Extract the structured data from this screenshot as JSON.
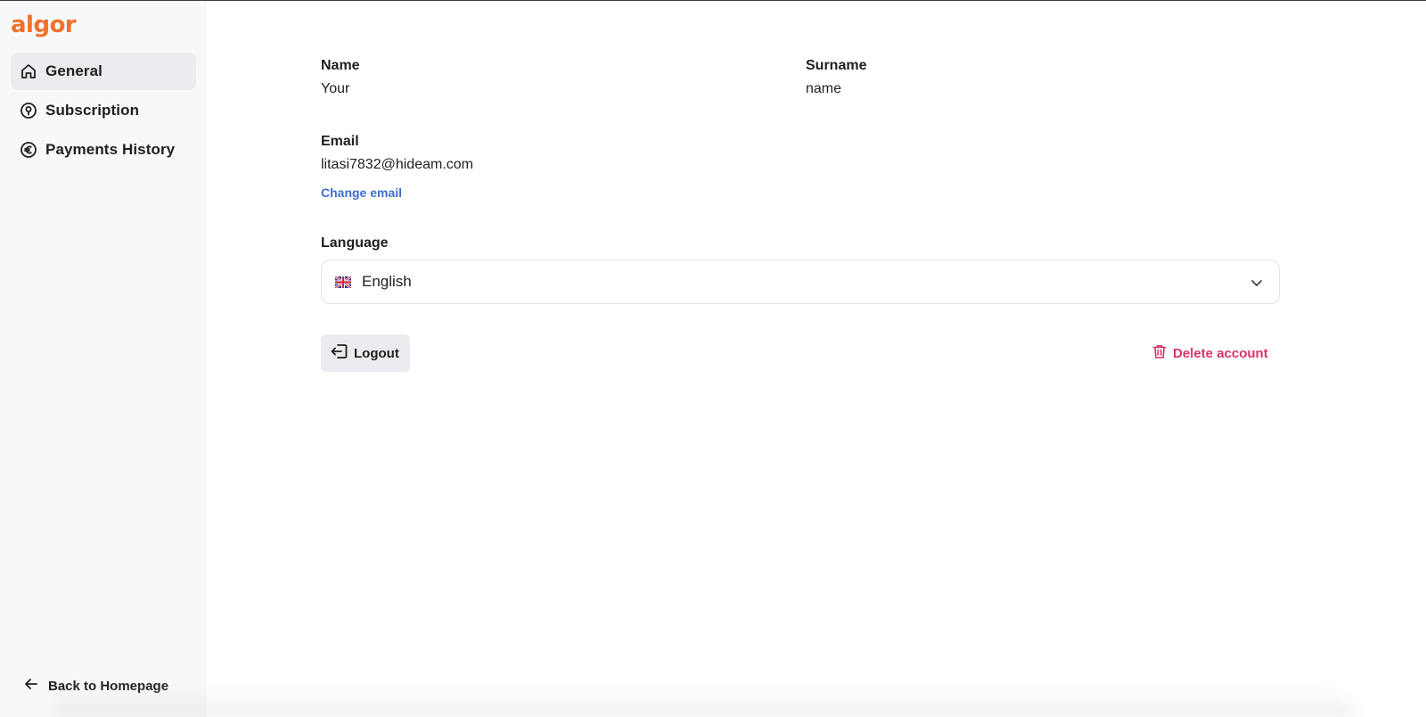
{
  "brand": {
    "logo_text": "algor",
    "accent": "#f0712c"
  },
  "sidebar": {
    "items": [
      {
        "label": "General",
        "icon": "home-icon",
        "active": true
      },
      {
        "label": "Subscription",
        "icon": "subscription-icon",
        "active": false
      },
      {
        "label": "Payments History",
        "icon": "euro-icon",
        "active": false
      }
    ],
    "back_label": "Back to Homepage"
  },
  "profile": {
    "name_label": "Name",
    "name_value": "Your",
    "surname_label": "Surname",
    "surname_value": "name",
    "email_label": "Email",
    "email_value": "litasi7832@hideam.com",
    "change_email_label": "Change email",
    "language_label": "Language",
    "language_value": "English",
    "language_flag": "uk-flag-icon"
  },
  "actions": {
    "logout_label": "Logout",
    "delete_label": "Delete account",
    "delete_color": "#d6336c",
    "link_color": "#3d6fcf"
  }
}
